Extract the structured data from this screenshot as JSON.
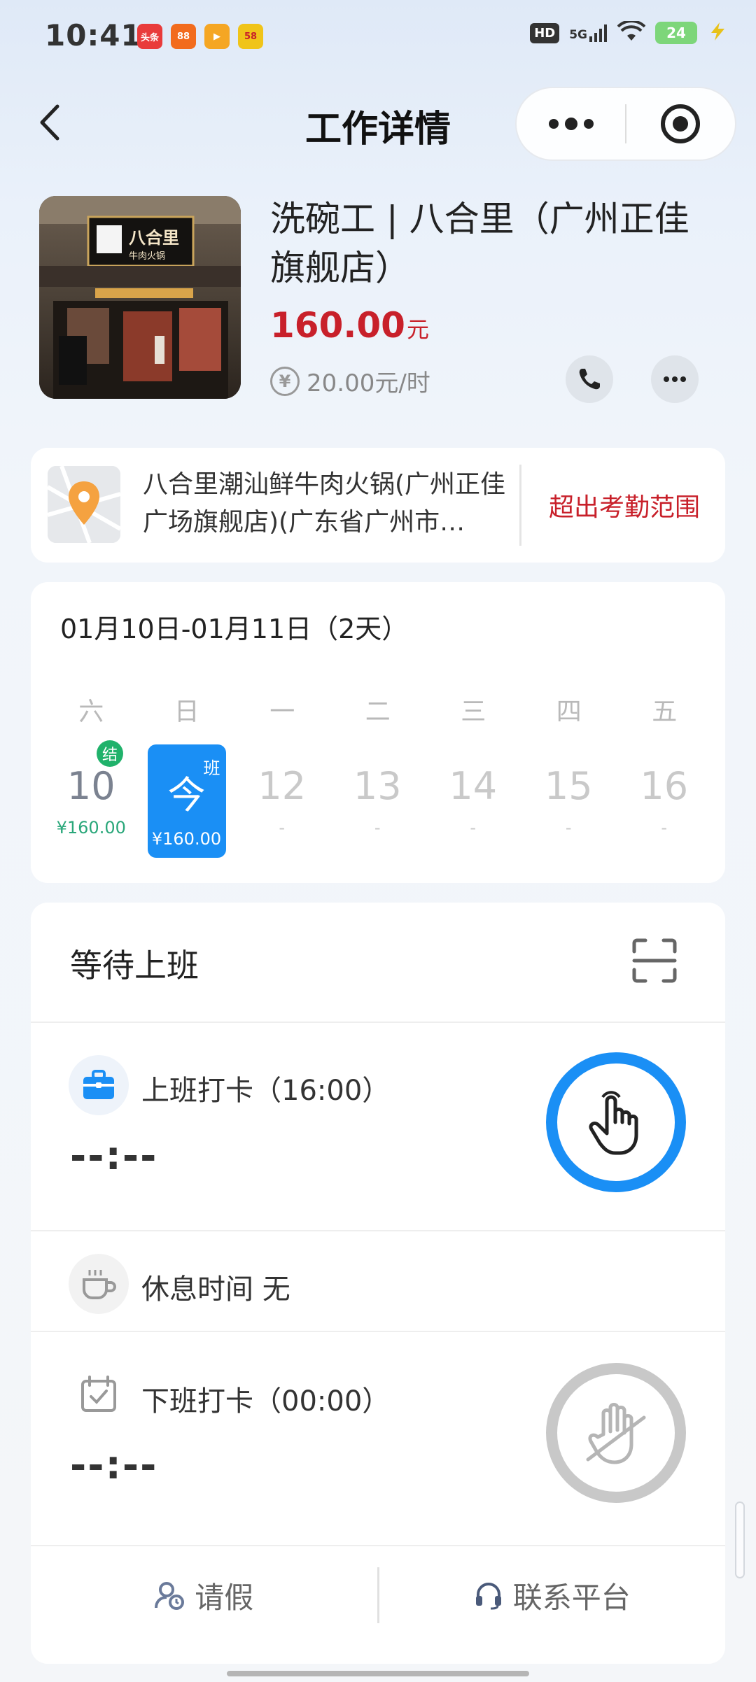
{
  "status_bar": {
    "time": "10:41",
    "apps": [
      {
        "icon": "toutiao-app-icon",
        "label": "头条",
        "color": "#e93b3b"
      },
      {
        "icon": "app-orange-icon",
        "label": "88",
        "color": "#f26b1d"
      },
      {
        "icon": "video-app-icon",
        "label": "▶",
        "color": "#f5a623"
      },
      {
        "icon": "58-app-icon",
        "label": "58",
        "color": "#f0c419"
      }
    ],
    "hd": "HD",
    "network": "5G",
    "battery": "24"
  },
  "nav": {
    "title": "工作详情"
  },
  "job": {
    "title": "洗碗工 | 八合里（广州正佳旗舰店）",
    "salary_amount": "160.00",
    "salary_unit": "元",
    "hourly_rate": "20.00元/时",
    "yen_symbol": "¥"
  },
  "location": {
    "address": "八合里潮汕鲜牛肉火锅(广州正佳广场旗舰店)(广东省广州市…",
    "status": "超出考勤范围"
  },
  "calendar": {
    "range": "01月10日-01月11日（2天）",
    "weekdays": [
      "六",
      "日",
      "一",
      "二",
      "三",
      "四",
      "五"
    ],
    "days": [
      {
        "num": "10",
        "sub": "¥160.00",
        "state": "past",
        "badge": "结"
      },
      {
        "num": "今",
        "sub": "¥160.00",
        "state": "today",
        "tag": "班"
      },
      {
        "num": "12",
        "sub": "-",
        "state": "future"
      },
      {
        "num": "13",
        "sub": "-",
        "state": "future"
      },
      {
        "num": "14",
        "sub": "-",
        "state": "future"
      },
      {
        "num": "15",
        "sub": "-",
        "state": "future"
      },
      {
        "num": "16",
        "sub": "-",
        "state": "future"
      }
    ]
  },
  "attendance": {
    "status_title": "等待上班",
    "clock_in_label": "上班打卡（16:00）",
    "clock_in_time": "--:--",
    "break_label": "休息时间  无",
    "clock_out_label": "下班打卡（00:00）",
    "clock_out_time": "--:--",
    "leave_label": "请假",
    "contact_label": "联系平台"
  },
  "colors": {
    "primary": "#1a8ff5",
    "accent_red": "#c8202a",
    "settled_green": "#20b26b"
  }
}
